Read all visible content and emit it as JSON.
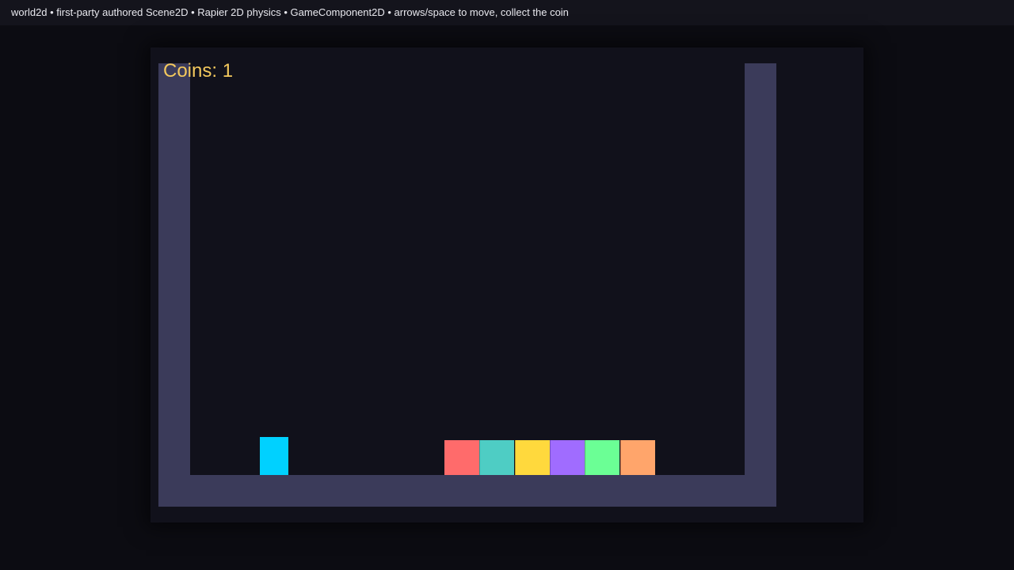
{
  "header": {
    "text": "world2d • first-party authored Scene2D • Rapier 2D physics • GameComponent2D • arrows/space to move, collect the coin"
  },
  "hud": {
    "coins_label": "Coins: 1",
    "color": "#f4c95d"
  },
  "colors": {
    "background": "#0c0c12",
    "canvas": "#11111b",
    "wall": "#3b3b5a",
    "player": "#00d1ff"
  },
  "crates": [
    {
      "color": "#ff6b6b"
    },
    {
      "color": "#4ecdc4"
    },
    {
      "color": "#ffd93d"
    },
    {
      "color": "#a06cff"
    },
    {
      "color": "#6bff95"
    },
    {
      "color": "#ffa56b"
    }
  ]
}
